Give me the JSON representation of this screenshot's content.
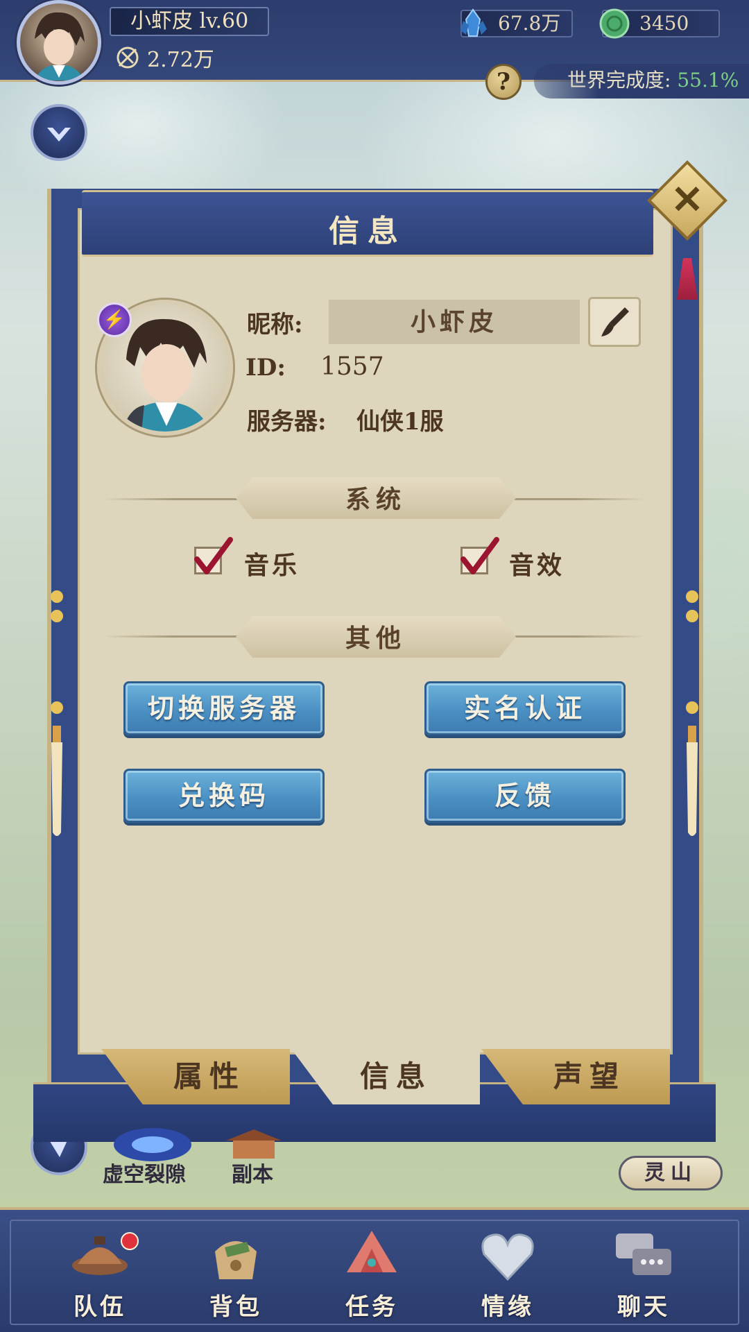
{
  "player": {
    "name_level": "小虾皮 lv.60",
    "power": "2.72万"
  },
  "currencies": {
    "crystal": "67.8万",
    "jade": "3450"
  },
  "world": {
    "completion_label": "世界完成度:",
    "completion_value": "55.1%"
  },
  "help": {
    "label": "?"
  },
  "dialog": {
    "title": "信息",
    "close_label": "✕",
    "nickname_label": "昵称:",
    "nickname_value": "小虾皮",
    "id_label": "ID:",
    "id_value": "1557",
    "server_label": "服务器:",
    "server_value": "仙侠1服",
    "system_section": "系统",
    "music_label": "音乐",
    "music_checked": true,
    "sfx_label": "音效",
    "sfx_checked": true,
    "other_section": "其他",
    "buttons": {
      "switch_server": "切换服务器",
      "real_name": "实名认证",
      "redeem_code": "兑换码",
      "feedback": "反馈"
    },
    "tabs": [
      {
        "label": "属性",
        "active": false
      },
      {
        "label": "信息",
        "active": true
      },
      {
        "label": "声望",
        "active": false
      }
    ]
  },
  "background": {
    "void_rift": "虚空裂隙",
    "dungeon": "副本",
    "lingshan": "灵山"
  },
  "bottom_nav": [
    {
      "label": "队伍",
      "icon": "team-icon",
      "badge": true
    },
    {
      "label": "背包",
      "icon": "backpack-icon",
      "badge": false
    },
    {
      "label": "任务",
      "icon": "quest-icon",
      "badge": false
    },
    {
      "label": "情缘",
      "icon": "bond-icon",
      "badge": false
    },
    {
      "label": "聊天",
      "icon": "chat-icon",
      "badge": false
    }
  ],
  "colors": {
    "navy": "#2c3d6d",
    "gold": "#c9b487",
    "paper": "#ddd5bc",
    "button_blue": "#4b90c3",
    "check_red": "#a0172e",
    "completion_green": "#7fcf8a"
  }
}
